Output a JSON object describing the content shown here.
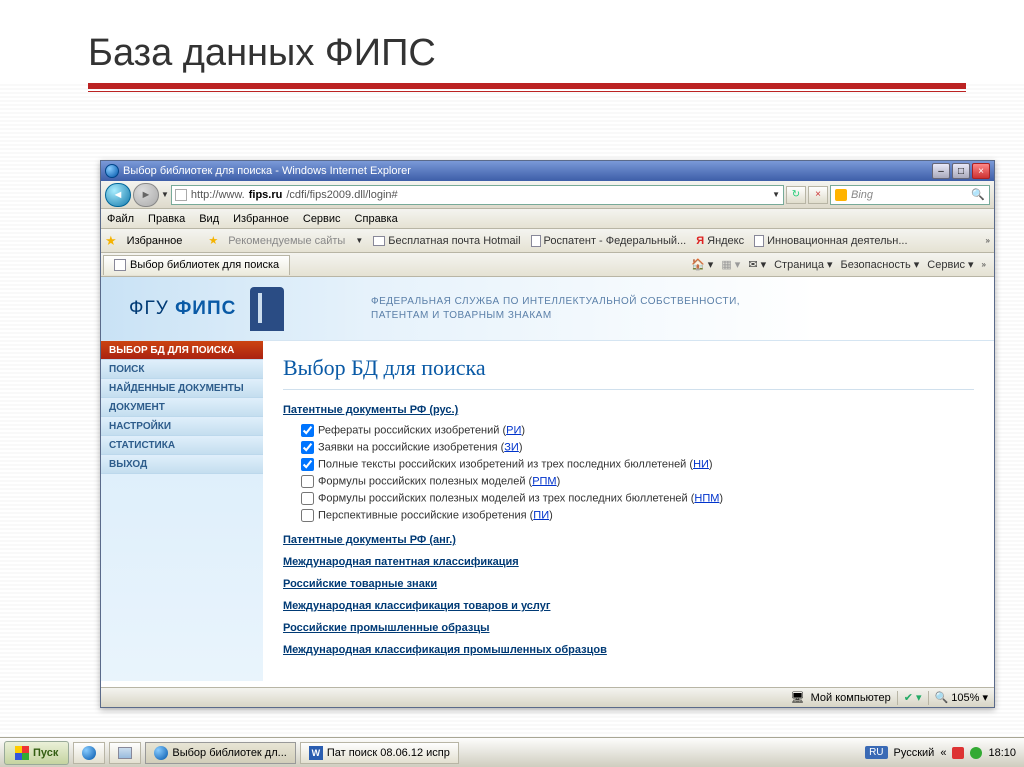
{
  "slide": {
    "title": "База данных ФИПС"
  },
  "window": {
    "title": "Выбор библиотек для поиска - Windows Internet Explorer"
  },
  "address": {
    "prefix": "http://www.",
    "host": "fips.ru",
    "path": "/cdfi/fips2009.dll/login#"
  },
  "search": {
    "placeholder": "Bing"
  },
  "menus": [
    "Файл",
    "Правка",
    "Вид",
    "Избранное",
    "Сервис",
    "Справка"
  ],
  "favbar": {
    "label": "Избранное",
    "items": [
      "Рекомендуемые сайты",
      "Бесплатная почта Hotmail",
      "Роспатент - Федеральный...",
      "Яндекс",
      "Инновационная деятельн..."
    ]
  },
  "tab": {
    "label": "Выбор библиотек для поиска"
  },
  "toolbar_right": {
    "home": "",
    "rss": "",
    "mail": "",
    "page": "Страница",
    "safety": "Безопасность",
    "service": "Сервис"
  },
  "logo": {
    "line1": "ФГУ ",
    "line2": "ФИПС"
  },
  "agency": {
    "line1": "ФЕДЕРАЛЬНАЯ СЛУЖБА ПО ИНТЕЛЛЕКТУАЛЬНОЙ СОБСТВЕННОСТИ,",
    "line2": "ПАТЕНТАМ И ТОВАРНЫМ ЗНАКАМ"
  },
  "sidebar": {
    "items": [
      {
        "label": "ВЫБОР БД ДЛЯ ПОИСКА",
        "active": true
      },
      {
        "label": "ПОИСК"
      },
      {
        "label": "НАЙДЕННЫЕ ДОКУМЕНТЫ"
      },
      {
        "label": "ДОКУМЕНТ"
      },
      {
        "label": "НАСТРОЙКИ"
      },
      {
        "label": "СТАТИСТИКА"
      },
      {
        "label": "ВЫХОД"
      }
    ]
  },
  "page": {
    "heading": "Выбор БД для поиска"
  },
  "sections": {
    "patent_ru": "Патентные документы РФ (рус.)",
    "checkboxes": [
      {
        "checked": true,
        "text": "Рефераты российских изобретений (",
        "link": "РИ",
        "after": ")"
      },
      {
        "checked": true,
        "text": "Заявки на российские изобретения (",
        "link": "ЗИ",
        "after": ")"
      },
      {
        "checked": true,
        "text": "Полные тексты российских изобретений из трех последних бюллетеней (",
        "link": "НИ",
        "after": ")"
      },
      {
        "checked": false,
        "text": "Формулы российских полезных моделей (",
        "link": "РПМ",
        "after": ")"
      },
      {
        "checked": false,
        "text": "Формулы российских полезных моделей из трех последних бюллетеней (",
        "link": "НПМ",
        "after": ")"
      },
      {
        "checked": false,
        "text": "Перспективные российские изобретения (",
        "link": "ПИ",
        "after": ")"
      }
    ],
    "others": [
      "Патентные документы РФ (анг.)",
      "Международная патентная классификация",
      "Российские товарные знаки",
      "Международная классификация товаров и услуг",
      "Российские промышленные образцы",
      "Международная классификация промышленных образцов"
    ]
  },
  "status": {
    "left": "",
    "right_text": "Мой компьютер",
    "zoom": "105%"
  },
  "taskbar": {
    "start": "Пуск",
    "items": [
      {
        "label": "Выбор библиотек дл...",
        "active": true
      },
      {
        "label": "Пат поиск 08.06.12 испр"
      }
    ],
    "lang_code": "RU",
    "lang_name": "Русский",
    "time": "18:10"
  }
}
